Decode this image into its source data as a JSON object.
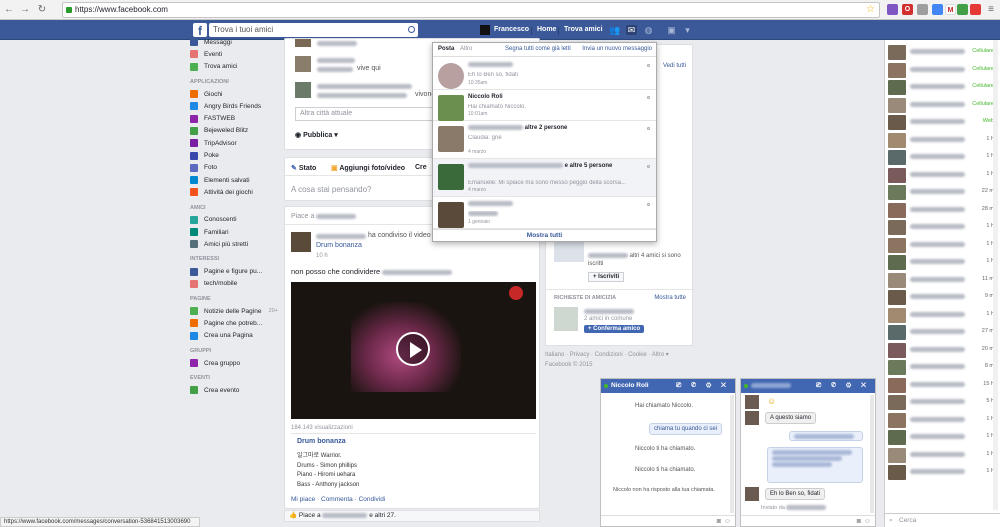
{
  "browser": {
    "url": "https://www.facebook.com",
    "status_url": "https://www.facebook.com/messages/conversation-536841513003690"
  },
  "topbar": {
    "search_placeholder": "Trova i tuoi amici",
    "user_name": "Francesco",
    "home": "Home",
    "find_friends": "Trova amici"
  },
  "leftnav": {
    "top_items": [
      "Messaggi",
      "Eventi",
      "Trova amici"
    ],
    "apps_header": "APPLICAZIONI",
    "apps": [
      "Giochi",
      "Angry Birds Friends",
      "FASTWEB",
      "Bejeweled Blitz",
      "TripAdvisor",
      "Poke",
      "Foto",
      "Elementi salvati",
      "Attività dei giochi"
    ],
    "friends_header": "AMICI",
    "friends": [
      "Conoscenti",
      "Familiari",
      "Amici più stretti"
    ],
    "interests_header": "INTERESSI",
    "interests": [
      "Pagine e figure pu...",
      "tech/mobile"
    ],
    "pages_header": "PAGINE",
    "pages": [
      "Notizie delle Pagine",
      "Pagine che potreb...",
      "Crea una Pagina"
    ],
    "pages_badge": "20+",
    "groups_header": "GRUPPI",
    "groups": [
      "Crea gruppo"
    ],
    "events_header": "EVENTI",
    "events": [
      "Crea evento"
    ]
  },
  "feed": {
    "vive_qui": "vive qui",
    "vivono": "vivono",
    "city_placeholder": "Altra città attuale",
    "publish": "Pubblica",
    "composer_tabs": [
      "Stato",
      "Aggiungi foto/video",
      "Cre"
    ],
    "composer_placeholder": "A cosa stai pensando?",
    "like_header": "Piace a",
    "share_text": "ha condiviso il video",
    "share_source": "Drum bonanza",
    "post_time": "10 h",
    "post_text": "non posso che condividere",
    "views": "184.143 visualizzazioni",
    "video_title": "Drum bonanza",
    "video_lines": [
      "일그마로 Warrior.",
      "Drums - Simon phillips",
      "Piano - Hiromi uehara",
      "Bass - Anthony jackson"
    ],
    "actions": [
      "Mi piace",
      "Commenta",
      "Condividi"
    ],
    "likes_prefix": "Piace a",
    "likes_suffix": "e altri 27."
  },
  "notifications": {
    "tab_posta": "Posta",
    "tab_altro": "Altro",
    "mark_read": "Segna tutti come già letti",
    "new_message": "Invia un nuovo messaggio",
    "items": [
      {
        "name": "",
        "snippet": "Eh lo Ben so, fidati",
        "time": "10:35am"
      },
      {
        "name": "Niccolo Roli",
        "snippet": "Hai chiamato Niccolo.",
        "time": "10:01am"
      },
      {
        "name": "altre 2 persone",
        "snippet": "Claudia: gne",
        "time": "4 marzo"
      },
      {
        "name": "e altre 5 persone",
        "snippet": "Emanuele: Mi spiace ma sono messo peggio della scorsa...",
        "time": "4 marzo"
      },
      {
        "name": "",
        "snippet": "",
        "time": "1 gennaio"
      }
    ],
    "show_all": "Mostra tutti"
  },
  "rightcol": {
    "see_all": "Vedi tutti",
    "group_suffix": "altri 4 amici si sono iscritti",
    "join": "Iscriviti",
    "requests_header": "RICHIESTE DI AMICIZIA",
    "show_all": "Mostra tutte",
    "mutual": "2 amici in comune",
    "confirm": "Conferma amico",
    "footer_links": [
      "Italiano",
      "Privacy",
      "Condizioni",
      "Cookie",
      "Altro"
    ],
    "footer_copy": "Facebook © 2015"
  },
  "chat_sidebar": {
    "statuses": [
      "Cellulare",
      "Cellulare",
      "Cellulare",
      "Cellulare",
      "Web",
      "1 h",
      "1 h",
      "1 h",
      "22 m",
      "28 m",
      "1 h",
      "1 h",
      "1 h",
      "11 m",
      "9 m",
      "1 h",
      "27 m",
      "20 m",
      "8 m",
      "15 h",
      "5 h",
      "1 h",
      "1 h",
      "1 h",
      "1 h"
    ],
    "search_placeholder": "Cerca"
  },
  "chat1": {
    "title": "Niccolo Roli",
    "msgs": [
      "Hai chiamato Niccolo.",
      "chiama tu quando ci sei",
      "Niccolo ti ha chiamato.",
      "Niccolo ti ha chiamato.",
      "Niccolo non ha risposto alla tua chiamata."
    ]
  },
  "chat2": {
    "msgs": [
      "A questo siamo",
      "Eh lo Ben so, fidati",
      "Inviato da"
    ],
    "smiley": "☺"
  },
  "colors": {
    "fb_blue": "#3b5998",
    "online_green": "#42b72a",
    "link": "#365899"
  }
}
